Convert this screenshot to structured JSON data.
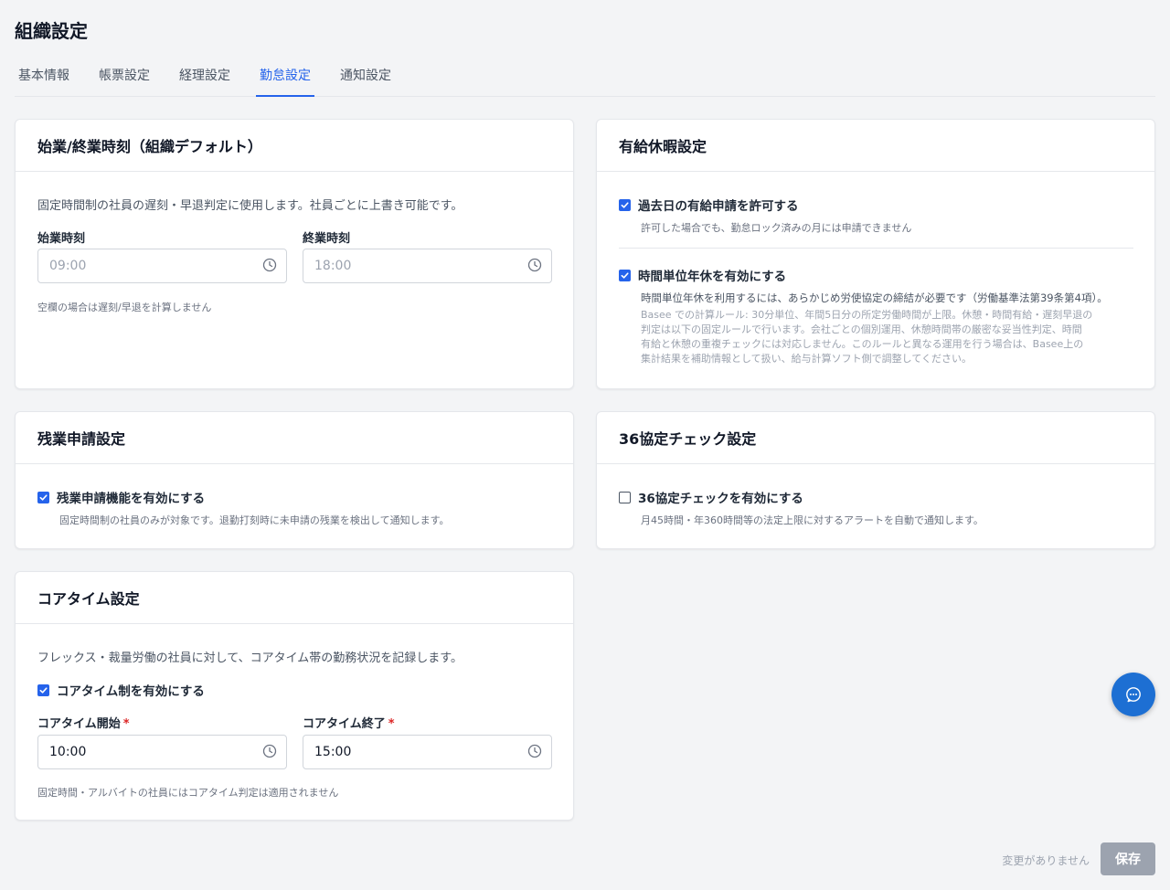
{
  "page": {
    "title": "組織設定"
  },
  "tabs": [
    {
      "label": "基本情報"
    },
    {
      "label": "帳票設定"
    },
    {
      "label": "経理設定"
    },
    {
      "label": "勤怠設定"
    },
    {
      "label": "通知設定"
    }
  ],
  "work_hours": {
    "title": "始業/終業時刻（組織デフォルト）",
    "description": "固定時間制の社員の遅刻・早退判定に使用します。社員ごとに上書き可能です。",
    "start_label": "始業時刻",
    "start_placeholder": "09:00",
    "end_label": "終業時刻",
    "end_placeholder": "18:00",
    "hint": "空欄の場合は遅刻/早退を計算しません"
  },
  "paid_leave": {
    "title": "有給休暇設定",
    "past_date": {
      "label": "過去日の有給申請を許可する",
      "checked": true,
      "hint": "許可した場合でも、勤怠ロック済みの月には申請できません"
    },
    "hourly": {
      "label": "時間単位年休を有効にする",
      "checked": true,
      "description": "時間単位年休を利用するには、あらかじめ労使協定の締結が必要です（労働基準法第39条第4項）。",
      "rules": [
        "Basee での計算ルール: 30分単位、年間5日分の所定労働時間が上限。休憩・時間有給・遅刻早退の",
        "判定は以下の固定ルールで行います。会社ごとの個別運用、休憩時間帯の厳密な妥当性判定、時間",
        "有給と休憩の重複チェックには対応しません。このルールと異なる運用を行う場合は、Basee上の",
        "集計結果を補助情報として扱い、給与計算ソフト側で調整してください。"
      ]
    }
  },
  "overtime": {
    "title": "残業申請設定",
    "label": "残業申請機能を有効にする",
    "checked": true,
    "hint": "固定時間制の社員のみが対象です。退勤打刻時に未申請の残業を検出して通知します。"
  },
  "agreement36": {
    "title": "36協定チェック設定",
    "label": "36協定チェックを有効にする",
    "checked": false,
    "hint": "月45時間・年360時間等の法定上限に対するアラートを自動で通知します。"
  },
  "core_time": {
    "title": "コアタイム設定",
    "description": "フレックス・裁量労働の社員に対して、コアタイム帯の勤務状況を記録します。",
    "label": "コアタイム制を有効にする",
    "checked": true,
    "start_label": "コアタイム開始",
    "start_value": "10:00",
    "end_label": "コアタイム終了",
    "end_value": "15:00",
    "required_mark": "*",
    "hint": "固定時間・アルバイトの社員にはコアタイム判定は適用されません"
  },
  "footer": {
    "status": "変更がありません",
    "save_label": "保存"
  },
  "colors": {
    "accent": "#2563eb",
    "chat_button": "#1d6fd3",
    "save_disabled": "#9ca3af"
  },
  "icons": {
    "time_input": "clock-icon",
    "chat": "chat-bubble-icon",
    "checkbox_checked": "check-icon"
  }
}
